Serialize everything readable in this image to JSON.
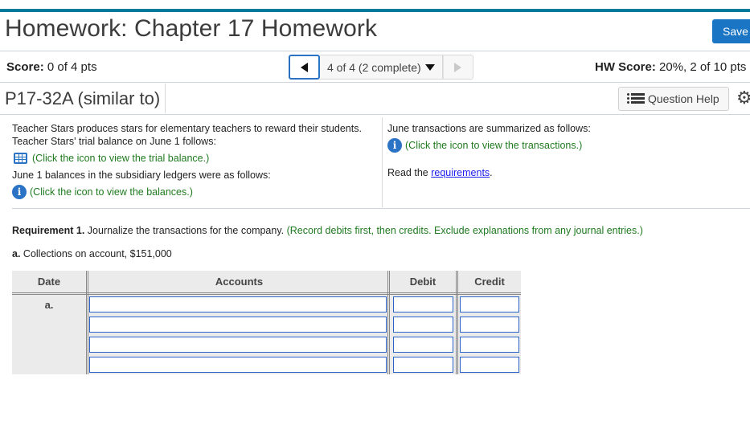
{
  "header": {
    "title": "Homework: Chapter 17 Homework",
    "save_label": "Save"
  },
  "score_bar": {
    "score_label": "Score:",
    "score_value": "0 of 4 pts",
    "nav_select_value": "4 of 4 (2 complete)",
    "hw_score_label": "HW Score:",
    "hw_score_value": "20%, 2 of 10 pts"
  },
  "question": {
    "id": "P17-32A (similar to)",
    "help_label": "Question Help"
  },
  "problem": {
    "left": {
      "intro_1": "Teacher Stars produces stars for elementary teachers to reward their students.",
      "intro_2": "Teacher Stars' trial balance on June 1 follows:",
      "trial_balance_link": "(Click the icon to view the trial balance.)",
      "subsidiary_text": "June 1 balances in the subsidiary ledgers were as follows:",
      "balances_link": "(Click the icon to view the balances.)"
    },
    "right": {
      "transactions_text": "June transactions are summarized as follows:",
      "transactions_link": "(Click the icon to view the transactions.)",
      "read_the": "Read the ",
      "requirements_link": "requirements",
      "period": "."
    }
  },
  "requirement": {
    "label": "Requirement 1.",
    "text": " Journalize the transactions for the company. ",
    "instruction": "(Record debits first, then credits. Exclude explanations from any journal entries.)"
  },
  "transaction": {
    "label": "a.",
    "text": " Collections on account, $151,000"
  },
  "journal": {
    "headers": [
      "Date",
      "Accounts",
      "Debit",
      "Credit"
    ],
    "date_label": "a.",
    "rows": [
      {
        "account": "",
        "debit": "",
        "credit": ""
      },
      {
        "account": "",
        "debit": "",
        "credit": ""
      },
      {
        "account": "",
        "debit": "",
        "credit": ""
      },
      {
        "account": "",
        "debit": "",
        "credit": ""
      }
    ]
  }
}
